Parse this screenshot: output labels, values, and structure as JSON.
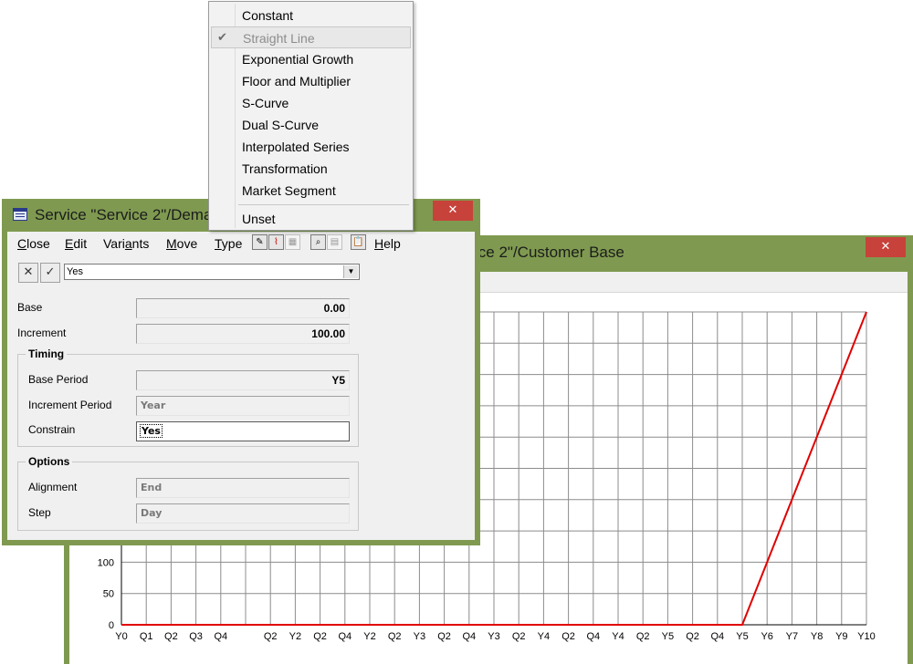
{
  "chart_window": {
    "title": "ice 2\"/Customer Base",
    "close_label": "✕"
  },
  "chart_data": {
    "type": "line",
    "x_tick_labels": [
      "Y0",
      "Q1",
      "Q2",
      "Q3",
      "Q4",
      "",
      "Q2",
      "Y2",
      "Q2",
      "Q4",
      "Y2",
      "Q2",
      "Y3",
      "Q2",
      "Q4",
      "Y3",
      "Q2",
      "Y4",
      "Q2",
      "Q4",
      "Y4",
      "Q2",
      "Y5",
      "Q2",
      "Q4",
      "Y5",
      "Y6",
      "Y7",
      "Y8",
      "Y9",
      "Y10"
    ],
    "y_tick_labels": [
      "0",
      "50",
      "100"
    ],
    "y_tick_values": [
      0,
      50,
      100
    ],
    "series": [
      {
        "color": "#e00000",
        "points": [
          [
            0,
            0
          ],
          [
            25,
            0
          ],
          [
            26,
            100
          ],
          [
            27,
            200
          ],
          [
            28,
            300
          ],
          [
            29,
            400
          ],
          [
            30,
            500
          ]
        ]
      }
    ]
  },
  "dialog": {
    "title": "Service \"Service 2\"/Demand/Customer Base",
    "close_label": "✕",
    "menu": [
      {
        "label": "Close",
        "u": "C",
        "rest": "lose"
      },
      {
        "label": "Edit",
        "u": "E",
        "rest": "dit"
      },
      {
        "label": "Variants",
        "pre": "Vari",
        "u": "a",
        "rest": "nts"
      },
      {
        "label": "Move",
        "u": "M",
        "rest": "ove"
      },
      {
        "label": "Type",
        "u": "T",
        "rest": "ype"
      },
      {
        "label": "Help",
        "u": "H",
        "rest": "elp"
      }
    ],
    "cancel_icon": "✕",
    "confirm_icon": "✓",
    "value_combo": "Yes",
    "base_label": "Base",
    "base_value": "0.00",
    "increment_label": "Increment",
    "increment_value": "100.00",
    "timing_title": "Timing",
    "base_period_label": "Base Period",
    "base_period_value": "Y5",
    "increment_period_label": "Increment Period",
    "increment_period_value": "Year",
    "constrain_label": "Constrain",
    "constrain_value": "Yes",
    "options_title": "Options",
    "alignment_label": "Alignment",
    "alignment_value": "End",
    "step_label": "Step",
    "step_value": "Day",
    "toolbar_icons": [
      "edit-icon",
      "chart-icon",
      "table-icon",
      "find-icon",
      "grid-icon",
      "clipboard-icon"
    ]
  },
  "popup_menu": {
    "items": [
      "Constant",
      "Straight Line",
      "Exponential Growth",
      "Floor and Multiplier",
      "S-Curve",
      "Dual S-Curve",
      "Interpolated Series",
      "Transformation",
      "Market Segment"
    ],
    "selected_index": 1,
    "check_mark": "✔",
    "unset_label": "Unset"
  }
}
